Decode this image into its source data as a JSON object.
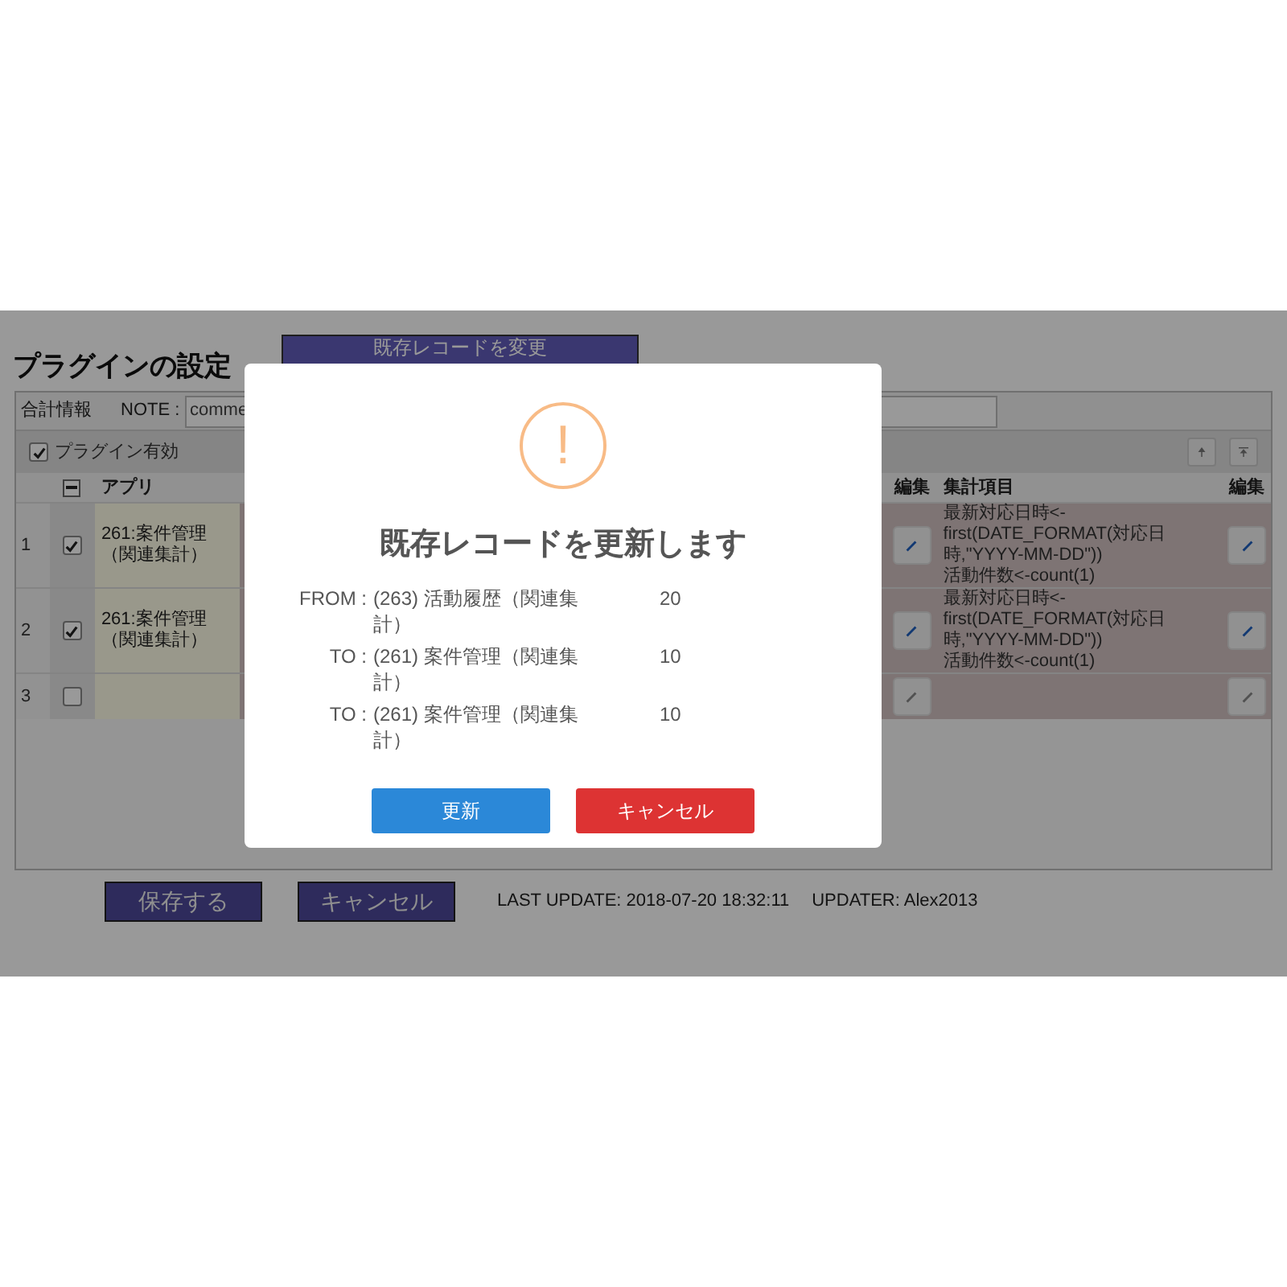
{
  "page": {
    "title": "プラグインの設定",
    "change_button": "既存レコードを変更",
    "total_label": "合計情報",
    "note_label": "NOTE :",
    "note_value": "comme",
    "plugin_enabled": {
      "label": "プラグイン有効",
      "checked": true
    },
    "table": {
      "select_all_partial": true,
      "columns": [
        "アプリ",
        "編集",
        "集計項目",
        "編集"
      ],
      "rows": [
        {
          "number": "1",
          "checked": true,
          "app": "261:案件管理（関連集計）",
          "aggregation": [
            "最新対応日時<-",
            "first(DATE_FORMAT(対応日",
            "時,\"YYYY-MM-DD\"))",
            "活動件数<-count(1)"
          ],
          "edit_disabled": false
        },
        {
          "number": "2",
          "checked": true,
          "app": "261:案件管理（関連集計）",
          "aggregation": [
            "最新対応日時<-",
            "first(DATE_FORMAT(対応日",
            "時,\"YYYY-MM-DD\"))",
            "活動件数<-count(1)"
          ],
          "edit_disabled": false
        },
        {
          "number": "3",
          "checked": false,
          "edit_disabled": true
        }
      ]
    },
    "footer": {
      "buttons": [
        "保存する",
        "キャンセル"
      ],
      "last_update": "LAST UPDATE: 2018-07-20 18:32:11",
      "updater": "UPDATER: Alex2013"
    }
  },
  "dialog": {
    "icon": "!",
    "title": "既存レコードを更新します",
    "rows": [
      {
        "label": "FROM :",
        "name": "(263) 活動履歴（関連集計）",
        "count": "20"
      },
      {
        "label": "TO :",
        "name": "(261) 案件管理（関連集計）",
        "count": "10"
      },
      {
        "label": "TO :",
        "name": "(261) 案件管理（関連集計）",
        "count": "10"
      }
    ],
    "buttons": [
      {
        "kind": "confirm",
        "label": "更新"
      },
      {
        "kind": "cancel",
        "label": "キャンセル"
      }
    ]
  }
}
